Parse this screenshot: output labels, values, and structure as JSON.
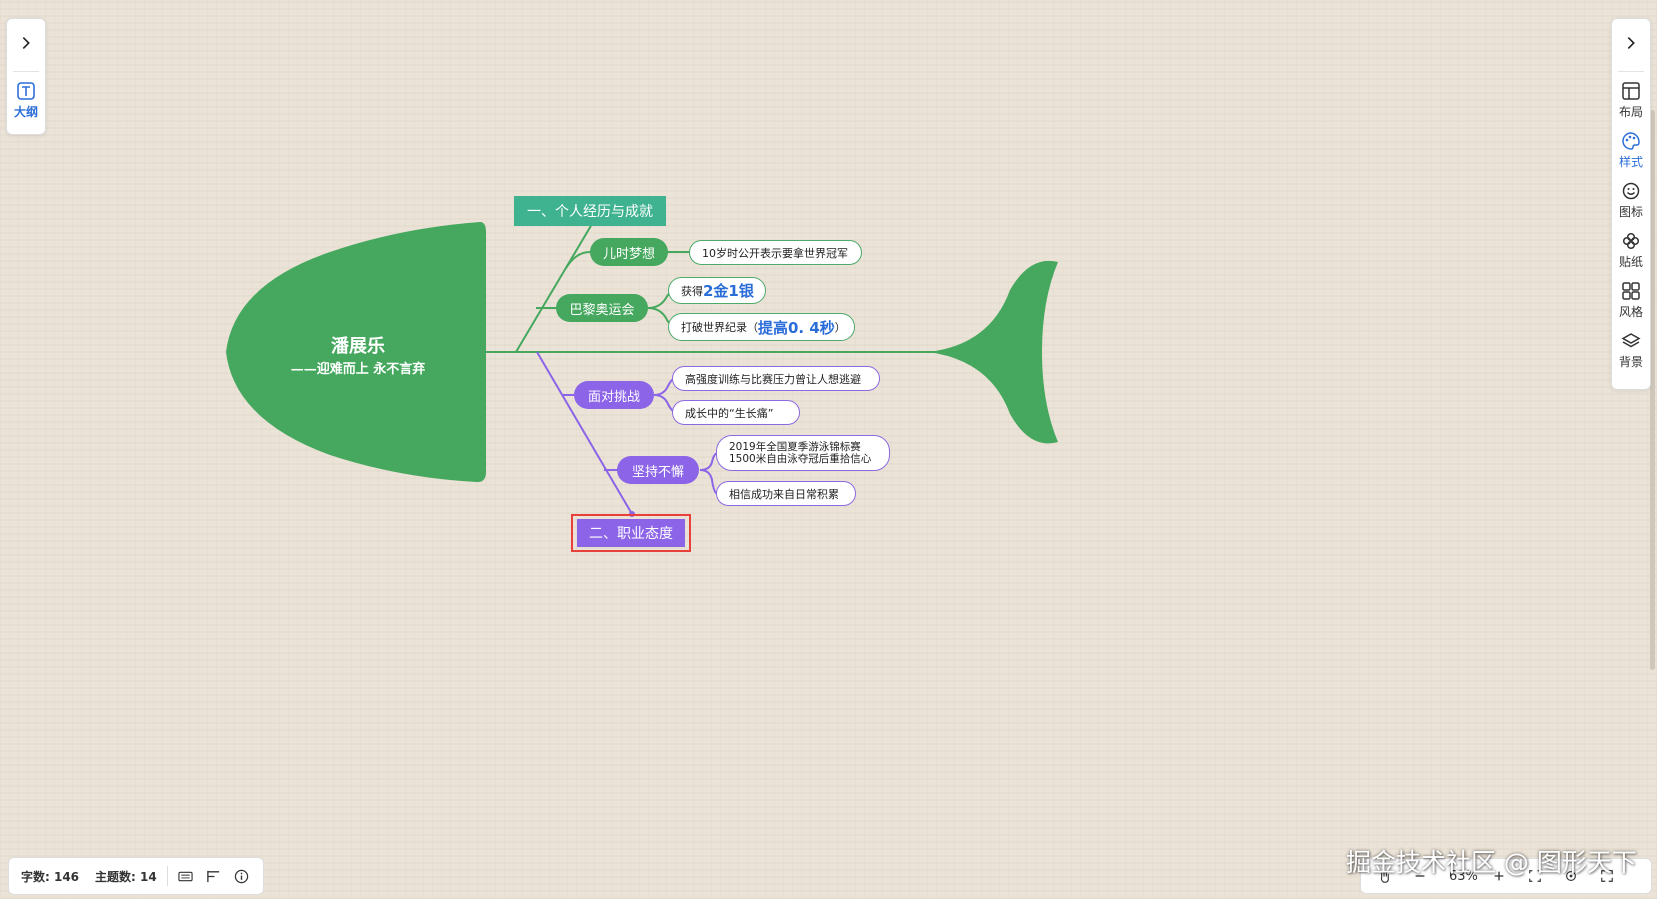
{
  "left_panel": {
    "outline_label": "大纲"
  },
  "right_panel": {
    "tools": [
      {
        "label": "布局",
        "icon": "layout-icon"
      },
      {
        "label": "样式",
        "icon": "palette-icon",
        "active": true
      },
      {
        "label": "图标",
        "icon": "smiley-icon"
      },
      {
        "label": "贴纸",
        "icon": "sticker-icon"
      },
      {
        "label": "风格",
        "icon": "grid-style-icon"
      },
      {
        "label": "背景",
        "icon": "layers-icon"
      }
    ]
  },
  "mindmap": {
    "root": {
      "title": "潘展乐",
      "subtitle": "——迎难而上  永不言弃"
    },
    "branch1": {
      "label": "一、个人经历与成就",
      "children": [
        {
          "label": "儿时梦想",
          "leaves": [
            "10岁时公开表示要拿世界冠军"
          ]
        },
        {
          "label": "巴黎奥运会",
          "leaves": [
            {
              "prefix": "获得",
              "em": "2金1银",
              "suffix": ""
            },
            {
              "prefix": "打破世界纪录（",
              "em": "提高0. 4秒",
              "suffix": "）"
            }
          ]
        }
      ]
    },
    "branch2": {
      "label": "二、职业态度",
      "children": [
        {
          "label": "面对挑战",
          "leaves": [
            "高强度训练与比赛压力曾让人想逃避",
            "成长中的“生长痛”"
          ]
        },
        {
          "label": "坚持不懈",
          "leaves": [
            {
              "line1": "2019年全国夏季游泳锦标赛",
              "line2": "1500米自由泳夺冠后重拾信心"
            },
            "相信成功来自日常积累"
          ]
        }
      ]
    }
  },
  "status": {
    "word_count": "字数: 146",
    "topic_count": "主题数: 14"
  },
  "zoom": {
    "value": "63%"
  },
  "watermark": "掘金技术社区 @ 图形天下",
  "colors": {
    "green": "#45a85e",
    "teal": "#3fb28f",
    "purple": "#8c64e8",
    "highlight": "#e8413c",
    "accent_blue": "#2d6fd8"
  }
}
